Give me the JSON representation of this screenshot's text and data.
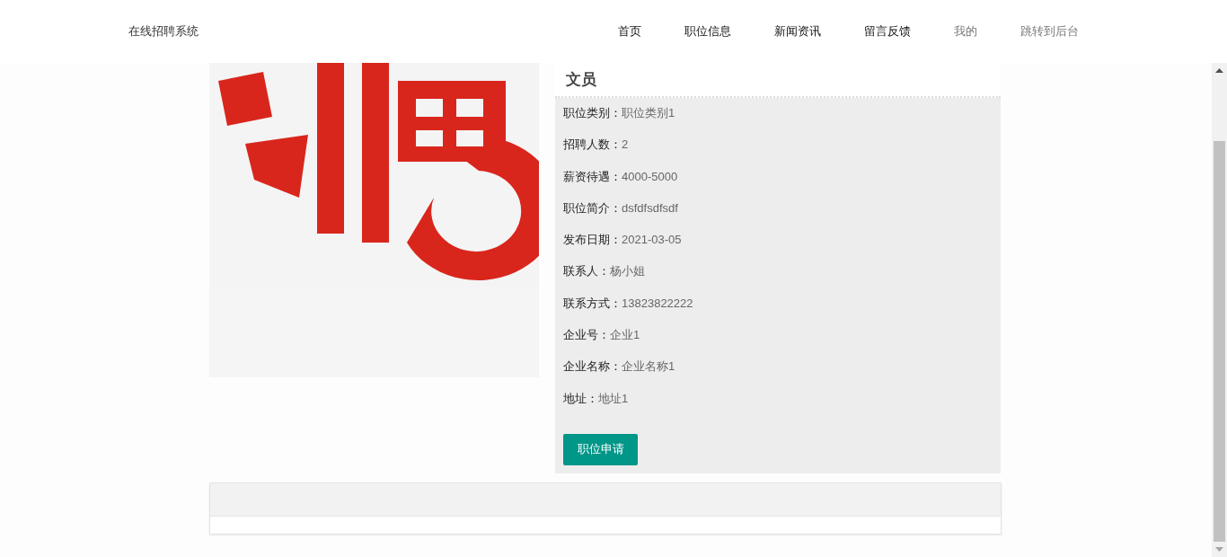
{
  "site_title": "在线招聘系统",
  "nav": [
    {
      "label": "首页",
      "dimmed": false
    },
    {
      "label": "职位信息",
      "dimmed": false
    },
    {
      "label": "新闻资讯",
      "dimmed": false
    },
    {
      "label": "留言反馈",
      "dimmed": false
    },
    {
      "label": "我的",
      "dimmed": true
    },
    {
      "label": "跳转到后台",
      "dimmed": true
    }
  ],
  "job": {
    "title": "文员",
    "fields": [
      {
        "label": "职位类别：",
        "value": "职位类别1"
      },
      {
        "label": "招聘人数：",
        "value": "2"
      },
      {
        "label": "薪资待遇：",
        "value": "4000-5000"
      },
      {
        "label": "职位简介：",
        "value": "dsfdfsdfsdf"
      },
      {
        "label": "发布日期：",
        "value": "2021-03-05"
      },
      {
        "label": "联系人：",
        "value": "杨小姐"
      },
      {
        "label": "联系方式：",
        "value": "13823822222"
      },
      {
        "label": "企业号：",
        "value": "企业1"
      },
      {
        "label": "企业名称：",
        "value": "企业名称1"
      },
      {
        "label": "地址：",
        "value": "地址1"
      }
    ],
    "apply_button": "职位申请"
  }
}
